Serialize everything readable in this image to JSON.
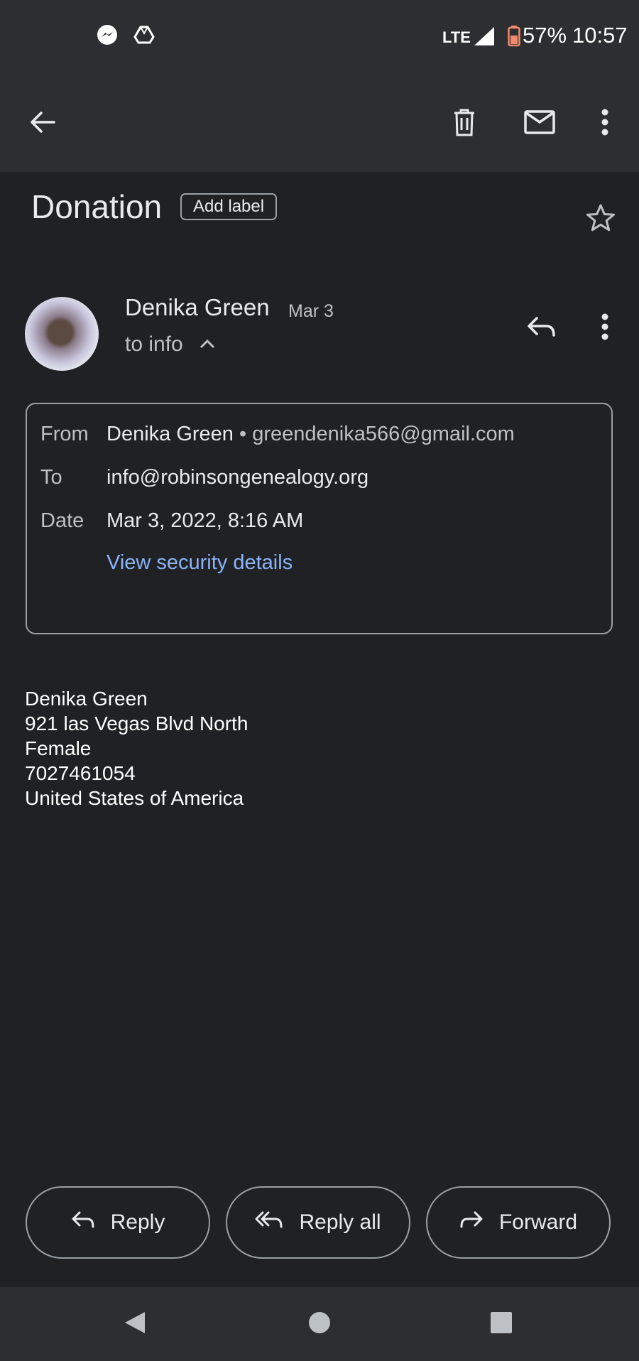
{
  "status_bar": {
    "network": "LTE",
    "battery": "57%",
    "time": "10:57",
    "icons": [
      "messenger-icon",
      "drive-icon",
      "signal-icon",
      "battery-icon"
    ]
  },
  "toolbar": {
    "icons": [
      "back-arrow-icon",
      "trash-icon",
      "mail-icon",
      "more-vert-icon"
    ]
  },
  "email": {
    "subject": "Donation",
    "add_label": "Add label",
    "sender_name": "Denika Green",
    "short_date": "Mar 3",
    "to_summary": "to info",
    "details": {
      "from_label": "From",
      "from_name": "Denika Green",
      "from_email": "• greendenika566@gmail.com",
      "to_label": "To",
      "to_value": "info@robinsongenealogy.org",
      "date_label": "Date",
      "date_value": "Mar 3, 2022, 8:16 AM",
      "security_link": "View security details"
    },
    "body_lines": [
      "Denika Green",
      "921 las Vegas Blvd North",
      "Female",
      "7027461054",
      "United States of America"
    ]
  },
  "actions": {
    "reply": "Reply",
    "reply_all": "Reply all",
    "forward": "Forward"
  },
  "colors": {
    "background": "#202124",
    "bars": "#2d2e31",
    "link": "#8ab4f8",
    "battery_accent": "#f28b6c"
  }
}
